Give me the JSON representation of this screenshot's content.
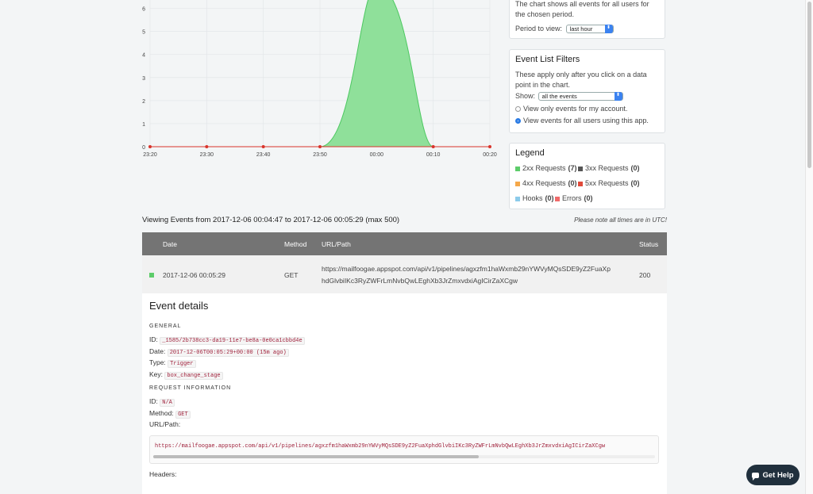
{
  "chart_data": {
    "type": "area",
    "x": [
      "23:20",
      "23:30",
      "23:40",
      "23:50",
      "00:00",
      "00:10",
      "00:20"
    ],
    "values": [
      0,
      0,
      0,
      0,
      7,
      0,
      0
    ],
    "yticks": [
      "0",
      "1",
      "2",
      "3",
      "4",
      "5",
      "6"
    ],
    "ylim": [
      0,
      6.5
    ],
    "colors": {
      "fill": "#8fe09a",
      "stroke": "#4cc860",
      "baseline": "#d9342b",
      "grid": "#e3e6e9"
    }
  },
  "period_panel": {
    "description": "The chart shows all events for all users for the chosen period.",
    "label": "Period to view:",
    "value": "last hour"
  },
  "filters_panel": {
    "title": "Event List Filters",
    "description": "These apply only after you click on a data point in the chart.",
    "show_label": "Show:",
    "show_value": "all the events",
    "radio1": "View only events for my account.",
    "radio2": "View events for all users using this app."
  },
  "legend_panel": {
    "title": "Legend",
    "items": [
      {
        "label": "2xx Requests",
        "count": "(7)",
        "color": "#5dcc6a"
      },
      {
        "label": "3xx Requests",
        "count": "(0)",
        "color": "#555555"
      },
      {
        "label": "4xx Requests",
        "count": "(0)",
        "color": "#f5a84a"
      },
      {
        "label": "5xx Requests",
        "count": "(0)",
        "color": "#e04a3a"
      },
      {
        "label": "Hooks",
        "count": "(0)",
        "color": "#8ccbea"
      },
      {
        "label": "Errors",
        "count": "(0)",
        "color": "#f06a6a"
      }
    ]
  },
  "viewing": "Viewing Events from 2017-12-06 00:04:47 to 2017-12-06 00:05:29 (max 500)",
  "note": "Please note all times are in UTC!",
  "table": {
    "headers": {
      "date": "Date",
      "method": "Method",
      "url": "URL/Path",
      "status": "Status"
    },
    "row": {
      "status_color": "#5dcc6a",
      "date": "2017-12-06 00:05:29",
      "method": "GET",
      "url_line1": "https://mailfoogae.appspot.com/api/v1/pipelines/agxzfm1haWxmb29nYWVyMQsSDE9yZ2FuaXp",
      "url_line2": "hdGlvbiIKc3RyZWFrLmNvbQwLEghXb3JrZmxvdxiAgICirZaXCgw",
      "status": "200"
    }
  },
  "details": {
    "title": "Event details",
    "general_header": "GENERAL",
    "id_label": "ID:",
    "id": "_1585/2b738cc3-da19-11e7-be8a-0e0ca1cbbd4e",
    "date_label": "Date:",
    "date": "2017-12-06T00:05:29+00:00 (15m ago)",
    "type_label": "Type:",
    "type": "Trigger",
    "key_label": "Key:",
    "key": "box_change_stage",
    "request_header": "REQUEST INFORMATION",
    "req_id_label": "ID:",
    "req_id": "N/A",
    "method_label": "Method:",
    "method": "GET",
    "urlpath_label": "URL/Path:",
    "urlpath": "https://mailfoogae.appspot.com/api/v1/pipelines/agxzfm1haWxmb29nYWVyMQsSDE9yZ2FuaXphdGlvbiIKc3RyZWFrLmNvbQwLEghXb3JrZmxvdxiAgICirZaXCgw",
    "headers_label": "Headers:"
  },
  "help_button": "Get Help"
}
